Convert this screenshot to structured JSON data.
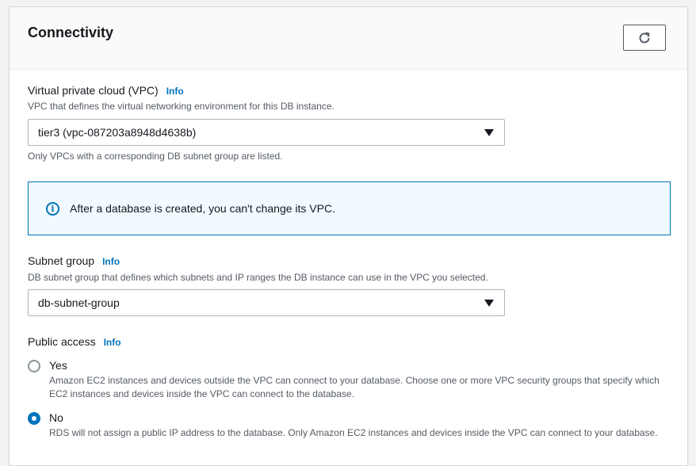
{
  "section": {
    "title": "Connectivity"
  },
  "refresh": {
    "icon": "refresh-icon"
  },
  "vpc": {
    "label": "Virtual private cloud (VPC)",
    "info": "Info",
    "description": "VPC that defines the virtual networking environment for this DB instance.",
    "selected": "tier3 (vpc-087203a8948d4638b)",
    "help": "Only VPCs with a corresponding DB subnet group are listed."
  },
  "alert": {
    "icon": "info-circle-icon",
    "text": "After a database is created, you can't change its VPC."
  },
  "subnet": {
    "label": "Subnet group",
    "info": "Info",
    "description": "DB subnet group that defines which subnets and IP ranges the DB instance can use in the VPC you selected.",
    "selected": "db-subnet-group"
  },
  "public_access": {
    "label": "Public access",
    "info": "Info",
    "options": [
      {
        "label": "Yes",
        "description": "Amazon EC2 instances and devices outside the VPC can connect to your database. Choose one or more VPC security groups that specify which EC2 instances and devices inside the VPC can connect to the database.",
        "checked": false
      },
      {
        "label": "No",
        "description": "RDS will not assign a public IP address to the database. Only Amazon EC2 instances and devices inside the VPC can connect to your database.",
        "checked": true
      }
    ]
  },
  "colors": {
    "accent": "#0073bb",
    "alert_bg": "#f1faff",
    "text": "#16191f",
    "muted": "#545b64"
  }
}
